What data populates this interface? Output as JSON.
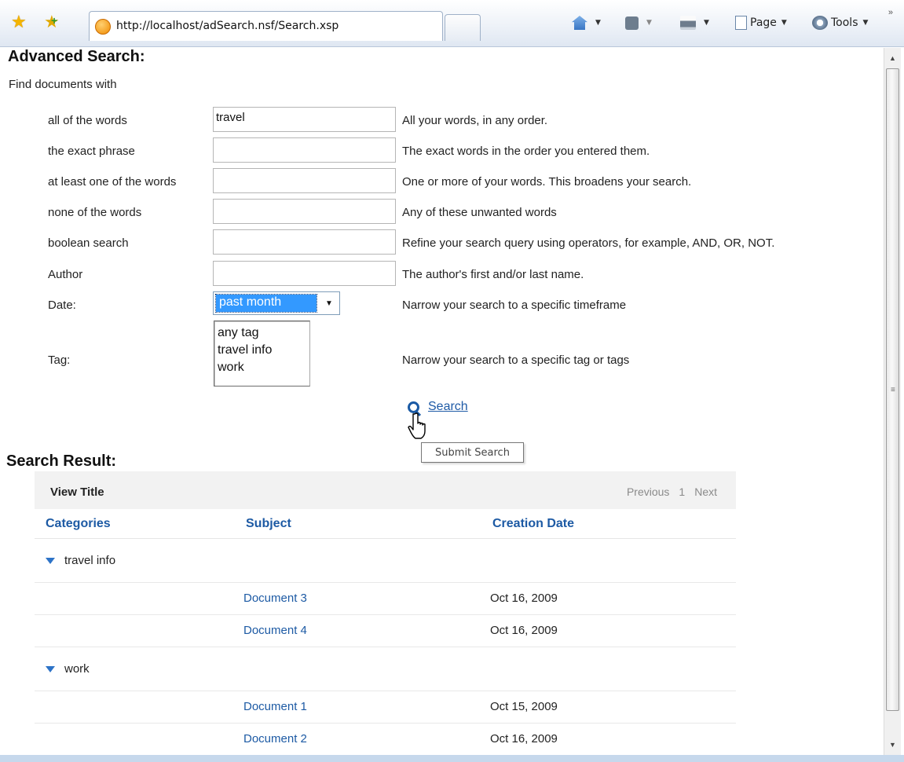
{
  "browser": {
    "url": "http://localhost/adSearch.nsf/Search.xsp",
    "commands": {
      "page": "Page",
      "tools": "Tools"
    },
    "icons": [
      "favorites-star-icon",
      "add-favorites-icon",
      "page-favicon",
      "home-icon",
      "feeds-icon",
      "print-icon",
      "page-icon",
      "tools-gear-icon"
    ]
  },
  "form": {
    "heading": "Advanced Search:",
    "intro": "Find documents with",
    "fields": [
      {
        "label": "all of the words",
        "value": "travel",
        "hint": "All your words, in any order."
      },
      {
        "label": "the exact phrase",
        "value": "",
        "hint": "The exact words in the order you entered them."
      },
      {
        "label": "at least one of the words",
        "value": "",
        "hint": "One or more of your words. This broadens your search."
      },
      {
        "label": "none of the words",
        "value": "",
        "hint": "Any of these unwanted words"
      },
      {
        "label": "boolean search",
        "value": "",
        "hint": "Refine your search query using operators, for example, AND, OR, NOT."
      },
      {
        "label": "Author",
        "value": "",
        "hint": "The author's first and/or last name."
      }
    ],
    "date": {
      "label": "Date:",
      "selected": "past month",
      "hint": "Narrow your search to a specific timeframe"
    },
    "tag": {
      "label": "Tag:",
      "options": [
        "any tag",
        "travel info",
        "work"
      ],
      "hint": "Narrow your search to a specific tag or tags"
    },
    "search_link": "Search",
    "tooltip": "Submit Search"
  },
  "results": {
    "heading": "Search Result:",
    "view_title": "View Title",
    "pager": {
      "previous": "Previous",
      "page": "1",
      "next": "Next"
    },
    "columns": [
      "Categories",
      "Subject",
      "Creation Date"
    ],
    "groups": [
      {
        "category": "travel info",
        "docs": [
          {
            "subject": "Document 3",
            "date": "Oct 16, 2009"
          },
          {
            "subject": "Document 4",
            "date": "Oct 16, 2009"
          }
        ]
      },
      {
        "category": "work",
        "docs": [
          {
            "subject": "Document 1",
            "date": "Oct 15, 2009"
          },
          {
            "subject": "Document 2",
            "date": "Oct 16, 2009"
          }
        ]
      }
    ]
  },
  "colors": {
    "link": "#1d5aa4",
    "selection": "#3399ff",
    "category_triangle": "#2d73c7"
  }
}
